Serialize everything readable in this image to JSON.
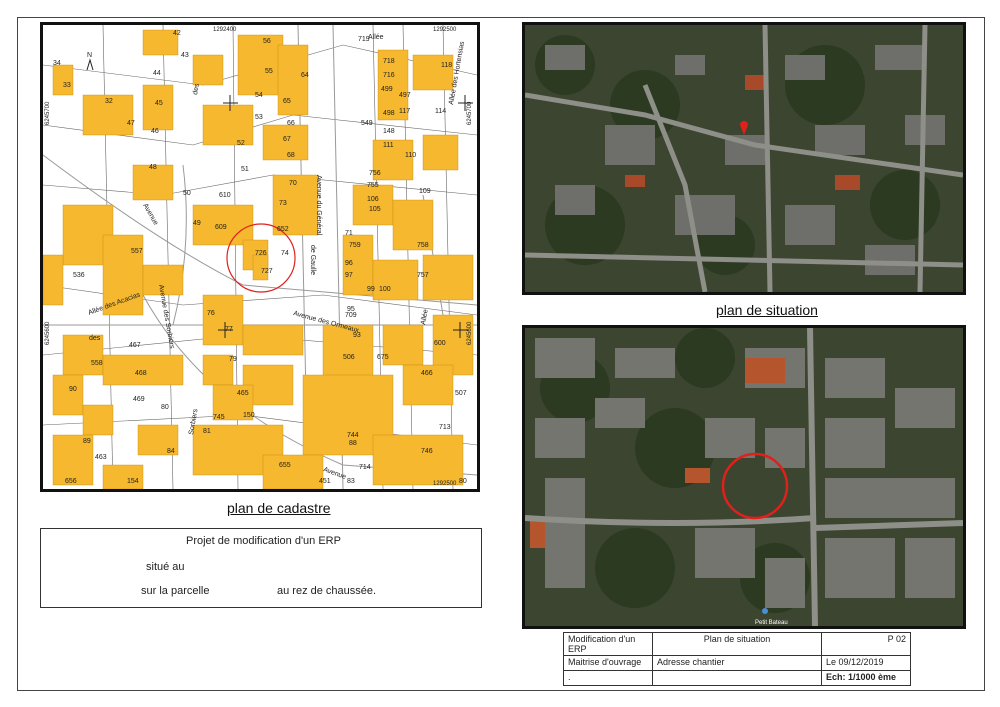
{
  "captions": {
    "cadastre": "plan de cadastre",
    "situation": "plan de situation"
  },
  "cadastre": {
    "north": "N",
    "coords": {
      "top_left": "1292400",
      "top_right": "1292500",
      "bottom_right": "1292500",
      "left_top": "6245700",
      "left_bottom": "6245600",
      "right_top": "6245700",
      "right_bottom": "6245600"
    },
    "parcels": [
      "42",
      "56",
      "719",
      "34",
      "43",
      "55",
      "64",
      "718",
      "118",
      "33",
      "44",
      "716",
      "32",
      "45",
      "54",
      "65",
      "499",
      "497",
      "47",
      "53",
      "46",
      "66",
      "549",
      "498",
      "117",
      "114",
      "52",
      "148",
      "67",
      "111",
      "110",
      "48",
      "68",
      "756",
      "51",
      "755",
      "70",
      "106",
      "109",
      "50",
      "610",
      "105",
      "73",
      "49",
      "609",
      "71",
      "652",
      "759",
      "758",
      "74",
      "726",
      "557",
      "727",
      "96",
      "97",
      "757",
      "536",
      "99",
      "100",
      "95",
      "76",
      "77",
      "709",
      "467",
      "93",
      "79",
      "506",
      "675",
      "558",
      "468",
      "466",
      "90",
      "469",
      "465",
      "507",
      "80",
      "150",
      "745",
      "81",
      "713",
      "89",
      "744",
      "88",
      "84",
      "463",
      "746",
      "655",
      "714",
      "656",
      "451",
      "83",
      "80",
      "154",
      "600"
    ],
    "streets": [
      "Allée",
      "des",
      "Avenue",
      "Avenue des Sorbiers",
      "Allée des Acacias",
      "Avenue du Général",
      "de Gaulle",
      "Avenue des Ormeaux",
      "Allée des Hortensias",
      "Allée",
      "des",
      "Sorbiers",
      "Avenue"
    ]
  },
  "project": {
    "title": "Projet de modification d'un ERP",
    "line1": "situé au",
    "line2a": "sur la parcelle",
    "line2b": "au rez de chaussée."
  },
  "cartouche": {
    "project": "Modification d'un ERP",
    "plan": "Plan de situation",
    "page": "P 02",
    "maitrise": "Maitrise d'ouvrage",
    "adresse": "Adresse chantier",
    "date": "Le  09/12/2019",
    "echelle": "Ech: 1/1000 ème",
    "dot": "."
  },
  "aerial_bottom": {
    "poi": "Petit Bateau"
  },
  "colors": {
    "parcel_fill": "#f5b82e",
    "highlight": "#e0201b",
    "aerial_base": "#3c4530"
  }
}
